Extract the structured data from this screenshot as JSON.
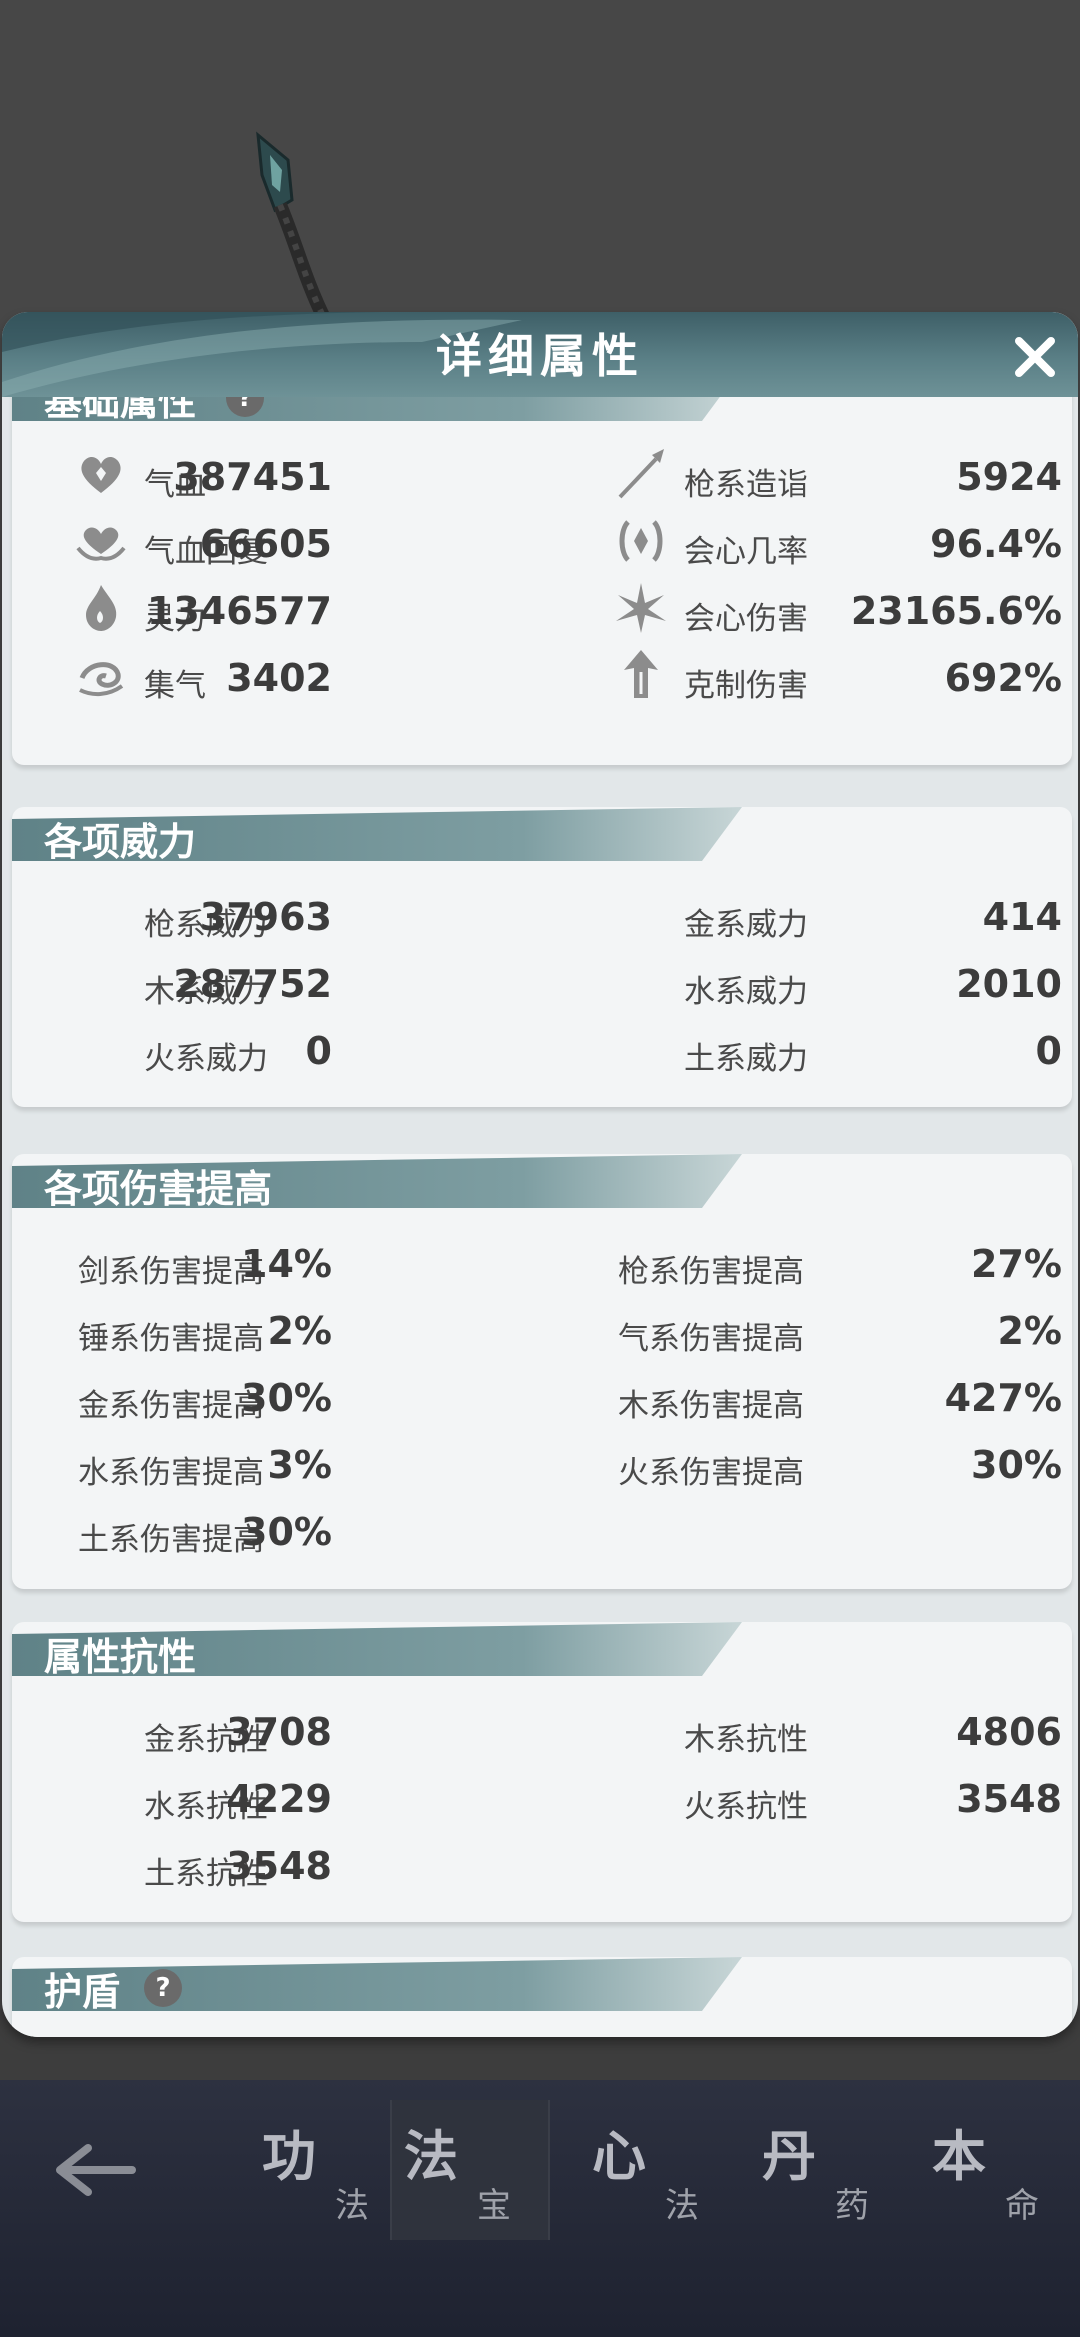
{
  "dialog": {
    "title": "详细属性"
  },
  "basic": {
    "title": "基础属性",
    "help": "?",
    "left": [
      {
        "icon": "heart-icon",
        "label": "气血",
        "value": "387451"
      },
      {
        "icon": "heart-regen-icon",
        "label": "气血回复",
        "value": "66605"
      },
      {
        "icon": "spirit-flame-icon",
        "label": "灵力",
        "value": "1346577"
      },
      {
        "icon": "swirl-icon",
        "label": "集气",
        "value": "3402"
      }
    ],
    "right": [
      {
        "icon": "spear-icon",
        "label": "枪系造诣",
        "value": "5924"
      },
      {
        "icon": "crit-rate-icon",
        "label": "会心几率",
        "value": "96.4%"
      },
      {
        "icon": "crit-damage-icon",
        "label": "会心伤害",
        "value": "23165.6%"
      },
      {
        "icon": "restrain-arrow-icon",
        "label": "克制伤害",
        "value": "692%"
      }
    ]
  },
  "power": {
    "title": "各项威力",
    "left": [
      {
        "label": "枪系威力",
        "value": "37963"
      },
      {
        "label": "木系威力",
        "value": "287752"
      },
      {
        "label": "火系威力",
        "value": "0"
      }
    ],
    "right": [
      {
        "label": "金系威力",
        "value": "414"
      },
      {
        "label": "水系威力",
        "value": "2010"
      },
      {
        "label": "土系威力",
        "value": "0"
      }
    ]
  },
  "damage": {
    "title": "各项伤害提高",
    "left": [
      {
        "label": "剑系伤害提高",
        "value": "14%"
      },
      {
        "label": "锤系伤害提高",
        "value": "2%"
      },
      {
        "label": "金系伤害提高",
        "value": "30%"
      },
      {
        "label": "水系伤害提高",
        "value": "3%"
      },
      {
        "label": "土系伤害提高",
        "value": "30%"
      }
    ],
    "right": [
      {
        "label": "枪系伤害提高",
        "value": "27%"
      },
      {
        "label": "气系伤害提高",
        "value": "2%"
      },
      {
        "label": "木系伤害提高",
        "value": "427%"
      },
      {
        "label": "火系伤害提高",
        "value": "30%"
      }
    ]
  },
  "resist": {
    "title": "属性抗性",
    "left": [
      {
        "label": "金系抗性",
        "value": "3708"
      },
      {
        "label": "水系抗性",
        "value": "4229"
      },
      {
        "label": "土系抗性",
        "value": "3548"
      }
    ],
    "right": [
      {
        "label": "木系抗性",
        "value": "4806"
      },
      {
        "label": "火系抗性",
        "value": "3548"
      }
    ]
  },
  "shield": {
    "title": "护盾",
    "help": "?"
  },
  "nav": {
    "tabs": [
      {
        "big": "功",
        "small": "法"
      },
      {
        "big": "法",
        "small": "宝"
      },
      {
        "big": "心",
        "small": "法"
      },
      {
        "big": "丹",
        "small": "药"
      },
      {
        "big": "本",
        "small": "命"
      }
    ]
  },
  "colors": {
    "header": "#4f727a",
    "panel": "#f3f5f6",
    "modal": "#e2e7e9",
    "nav": "#262a36"
  }
}
